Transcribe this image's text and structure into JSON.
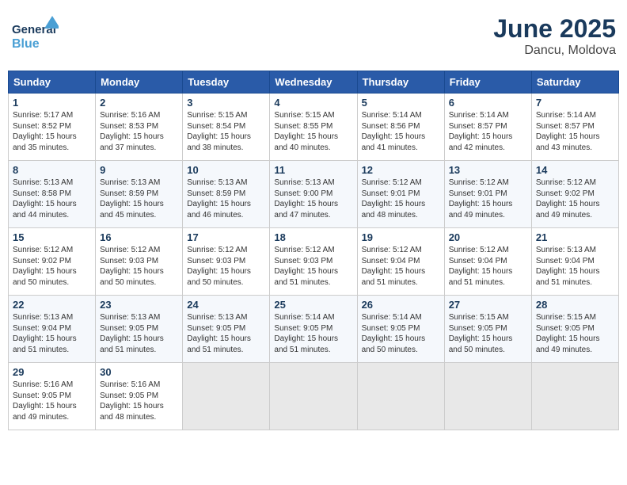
{
  "header": {
    "title": "June 2025",
    "subtitle": "Dancu, Moldova",
    "logo_general": "General",
    "logo_blue": "Blue"
  },
  "days_of_week": [
    "Sunday",
    "Monday",
    "Tuesday",
    "Wednesday",
    "Thursday",
    "Friday",
    "Saturday"
  ],
  "weeks": [
    [
      {
        "day": "1",
        "sunrise": "Sunrise: 5:17 AM",
        "sunset": "Sunset: 8:52 PM",
        "daylight": "Daylight: 15 hours and 35 minutes."
      },
      {
        "day": "2",
        "sunrise": "Sunrise: 5:16 AM",
        "sunset": "Sunset: 8:53 PM",
        "daylight": "Daylight: 15 hours and 37 minutes."
      },
      {
        "day": "3",
        "sunrise": "Sunrise: 5:15 AM",
        "sunset": "Sunset: 8:54 PM",
        "daylight": "Daylight: 15 hours and 38 minutes."
      },
      {
        "day": "4",
        "sunrise": "Sunrise: 5:15 AM",
        "sunset": "Sunset: 8:55 PM",
        "daylight": "Daylight: 15 hours and 40 minutes."
      },
      {
        "day": "5",
        "sunrise": "Sunrise: 5:14 AM",
        "sunset": "Sunset: 8:56 PM",
        "daylight": "Daylight: 15 hours and 41 minutes."
      },
      {
        "day": "6",
        "sunrise": "Sunrise: 5:14 AM",
        "sunset": "Sunset: 8:57 PM",
        "daylight": "Daylight: 15 hours and 42 minutes."
      },
      {
        "day": "7",
        "sunrise": "Sunrise: 5:14 AM",
        "sunset": "Sunset: 8:57 PM",
        "daylight": "Daylight: 15 hours and 43 minutes."
      }
    ],
    [
      {
        "day": "8",
        "sunrise": "Sunrise: 5:13 AM",
        "sunset": "Sunset: 8:58 PM",
        "daylight": "Daylight: 15 hours and 44 minutes."
      },
      {
        "day": "9",
        "sunrise": "Sunrise: 5:13 AM",
        "sunset": "Sunset: 8:59 PM",
        "daylight": "Daylight: 15 hours and 45 minutes."
      },
      {
        "day": "10",
        "sunrise": "Sunrise: 5:13 AM",
        "sunset": "Sunset: 8:59 PM",
        "daylight": "Daylight: 15 hours and 46 minutes."
      },
      {
        "day": "11",
        "sunrise": "Sunrise: 5:13 AM",
        "sunset": "Sunset: 9:00 PM",
        "daylight": "Daylight: 15 hours and 47 minutes."
      },
      {
        "day": "12",
        "sunrise": "Sunrise: 5:12 AM",
        "sunset": "Sunset: 9:01 PM",
        "daylight": "Daylight: 15 hours and 48 minutes."
      },
      {
        "day": "13",
        "sunrise": "Sunrise: 5:12 AM",
        "sunset": "Sunset: 9:01 PM",
        "daylight": "Daylight: 15 hours and 49 minutes."
      },
      {
        "day": "14",
        "sunrise": "Sunrise: 5:12 AM",
        "sunset": "Sunset: 9:02 PM",
        "daylight": "Daylight: 15 hours and 49 minutes."
      }
    ],
    [
      {
        "day": "15",
        "sunrise": "Sunrise: 5:12 AM",
        "sunset": "Sunset: 9:02 PM",
        "daylight": "Daylight: 15 hours and 50 minutes."
      },
      {
        "day": "16",
        "sunrise": "Sunrise: 5:12 AM",
        "sunset": "Sunset: 9:03 PM",
        "daylight": "Daylight: 15 hours and 50 minutes."
      },
      {
        "day": "17",
        "sunrise": "Sunrise: 5:12 AM",
        "sunset": "Sunset: 9:03 PM",
        "daylight": "Daylight: 15 hours and 50 minutes."
      },
      {
        "day": "18",
        "sunrise": "Sunrise: 5:12 AM",
        "sunset": "Sunset: 9:03 PM",
        "daylight": "Daylight: 15 hours and 51 minutes."
      },
      {
        "day": "19",
        "sunrise": "Sunrise: 5:12 AM",
        "sunset": "Sunset: 9:04 PM",
        "daylight": "Daylight: 15 hours and 51 minutes."
      },
      {
        "day": "20",
        "sunrise": "Sunrise: 5:12 AM",
        "sunset": "Sunset: 9:04 PM",
        "daylight": "Daylight: 15 hours and 51 minutes."
      },
      {
        "day": "21",
        "sunrise": "Sunrise: 5:13 AM",
        "sunset": "Sunset: 9:04 PM",
        "daylight": "Daylight: 15 hours and 51 minutes."
      }
    ],
    [
      {
        "day": "22",
        "sunrise": "Sunrise: 5:13 AM",
        "sunset": "Sunset: 9:04 PM",
        "daylight": "Daylight: 15 hours and 51 minutes."
      },
      {
        "day": "23",
        "sunrise": "Sunrise: 5:13 AM",
        "sunset": "Sunset: 9:05 PM",
        "daylight": "Daylight: 15 hours and 51 minutes."
      },
      {
        "day": "24",
        "sunrise": "Sunrise: 5:13 AM",
        "sunset": "Sunset: 9:05 PM",
        "daylight": "Daylight: 15 hours and 51 minutes."
      },
      {
        "day": "25",
        "sunrise": "Sunrise: 5:14 AM",
        "sunset": "Sunset: 9:05 PM",
        "daylight": "Daylight: 15 hours and 51 minutes."
      },
      {
        "day": "26",
        "sunrise": "Sunrise: 5:14 AM",
        "sunset": "Sunset: 9:05 PM",
        "daylight": "Daylight: 15 hours and 50 minutes."
      },
      {
        "day": "27",
        "sunrise": "Sunrise: 5:15 AM",
        "sunset": "Sunset: 9:05 PM",
        "daylight": "Daylight: 15 hours and 50 minutes."
      },
      {
        "day": "28",
        "sunrise": "Sunrise: 5:15 AM",
        "sunset": "Sunset: 9:05 PM",
        "daylight": "Daylight: 15 hours and 49 minutes."
      }
    ],
    [
      {
        "day": "29",
        "sunrise": "Sunrise: 5:16 AM",
        "sunset": "Sunset: 9:05 PM",
        "daylight": "Daylight: 15 hours and 49 minutes."
      },
      {
        "day": "30",
        "sunrise": "Sunrise: 5:16 AM",
        "sunset": "Sunset: 9:05 PM",
        "daylight": "Daylight: 15 hours and 48 minutes."
      },
      null,
      null,
      null,
      null,
      null
    ]
  ]
}
